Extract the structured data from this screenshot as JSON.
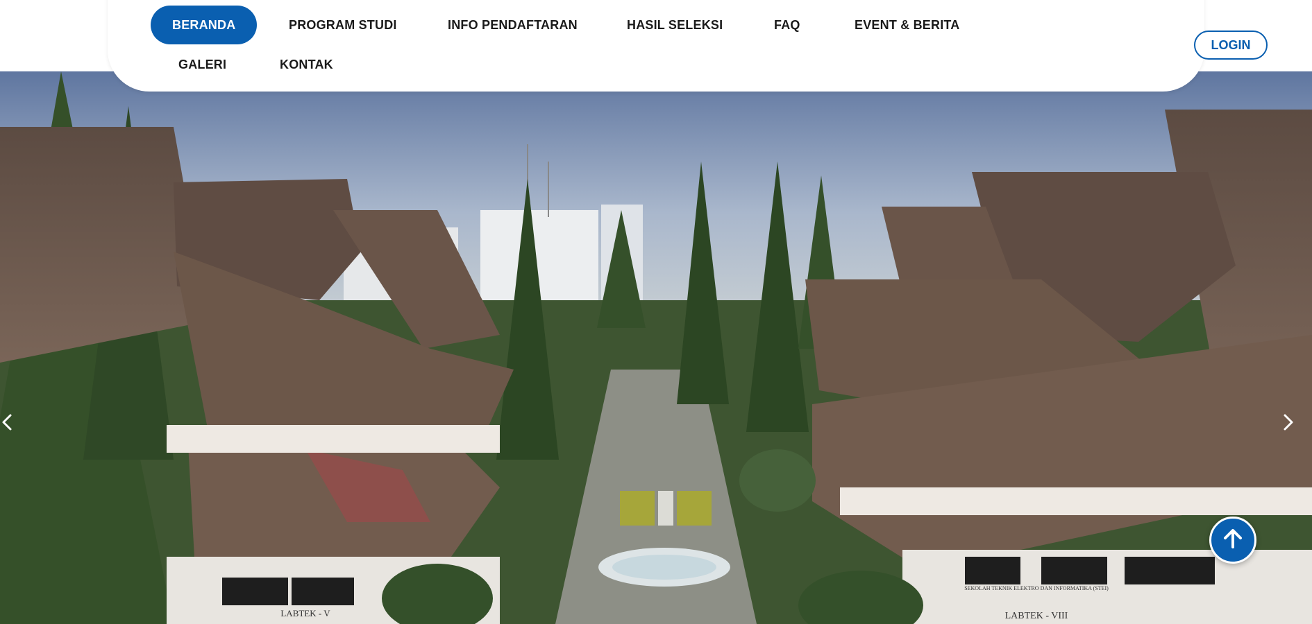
{
  "nav": {
    "items": [
      {
        "label": "BERANDA",
        "active": true
      },
      {
        "label": "PROGRAM STUDI"
      },
      {
        "label": "INFO PENDAFTARAN"
      },
      {
        "label": "HASIL SELEKSI"
      },
      {
        "label": "FAQ"
      },
      {
        "label": "EVENT & BERITA"
      },
      {
        "label": "GALERI"
      },
      {
        "label": "KONTAK"
      }
    ],
    "login_label": "LOGIN"
  },
  "hero": {
    "building_left_sign": "LABTEK - V",
    "building_right_sign": "LABTEK - VIII",
    "building_right_plaque": "SEKOLAH TEKNIK ELEKTRO DAN INFORMATIKA (STEI)"
  },
  "icons": {
    "prev": "chevron-left-icon",
    "next": "chevron-right-icon",
    "back_to_top": "arrow-up-icon"
  },
  "colors": {
    "accent": "#0a5fb0",
    "navbar_bg": "#ffffff"
  }
}
